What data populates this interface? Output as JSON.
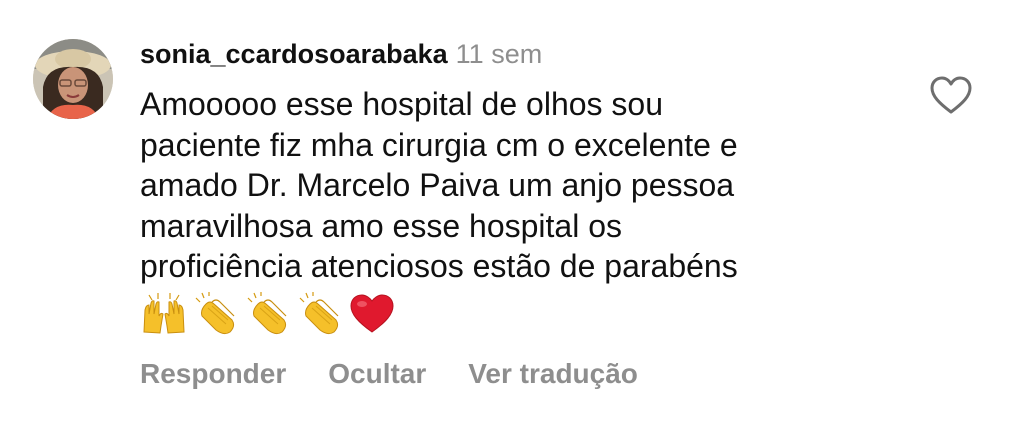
{
  "comment": {
    "username": "sonia_ccardosoarabaka",
    "time": "11 sem",
    "text_lines": [
      "Amooooo esse hospital de olhos sou",
      "paciente fiz mha cirurgia cm o excelente e",
      "amado Dr. Marcelo Paiva um anjo pessoa",
      "maravilhosa amo esse hospital os",
      "proficiência atenciosos estão de parabéns"
    ],
    "emojis": [
      "raising-hands",
      "clapping-hands",
      "clapping-hands",
      "clapping-hands",
      "red-heart"
    ],
    "avatar_icon": "avatar-woman-sunhat"
  },
  "actions": {
    "reply": "Responder",
    "hide": "Ocultar",
    "translate": "Ver tradução"
  },
  "like_icon": "heart-outline-icon",
  "colors": {
    "text": "#111111",
    "muted": "#8e8e8e",
    "emoji_yellow": "#f5c02a",
    "heart_red": "#e0192e"
  }
}
